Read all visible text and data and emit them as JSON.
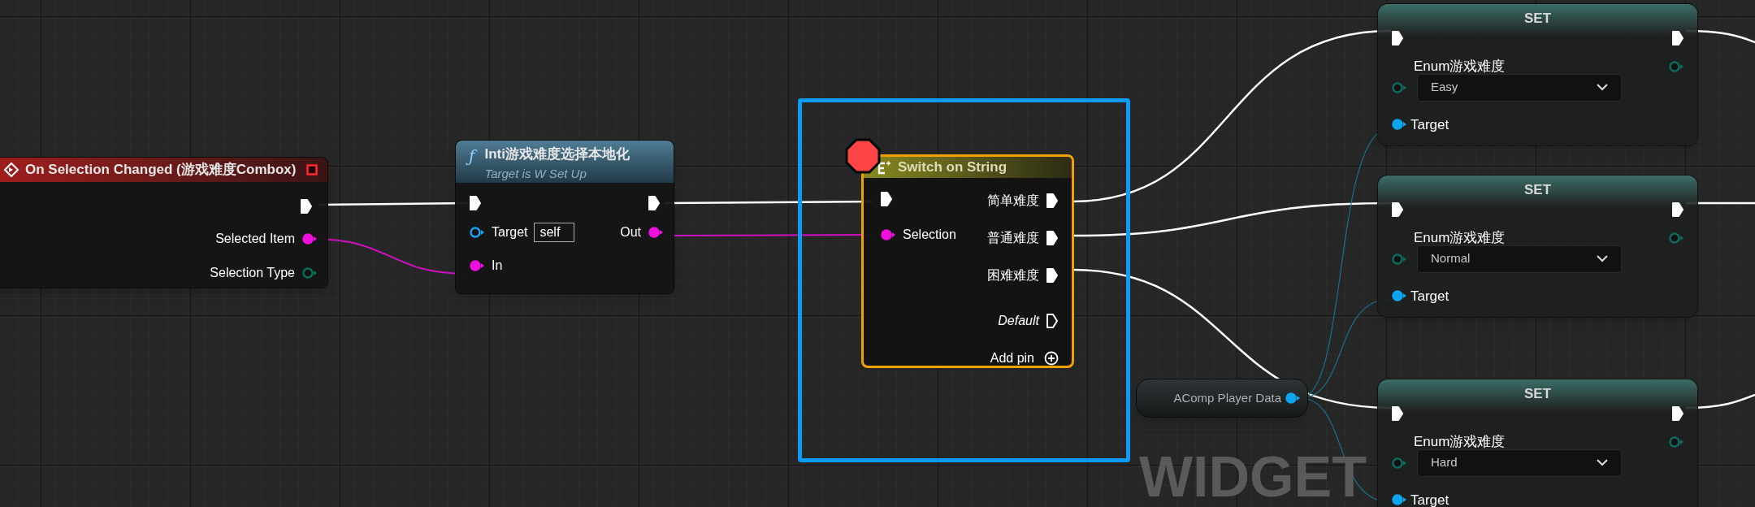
{
  "event_node": {
    "title": "On Selection Changed (游戏难度Combox)",
    "pins": [
      {
        "label": "Selected Item",
        "kind": "object"
      },
      {
        "label": "Selection Type",
        "kind": "enum"
      }
    ]
  },
  "function_node": {
    "icon": "ƒ",
    "title": "Inti游戏难度选择本地化",
    "subtitle": "Target is W Set Up",
    "inputs": [
      {
        "label": "Target",
        "kind": "target",
        "value": "self"
      },
      {
        "label": "In",
        "kind": "object"
      }
    ],
    "outputs": [
      {
        "label": "Out",
        "kind": "object"
      }
    ]
  },
  "switch_node": {
    "title": "Switch on String",
    "selected": true,
    "breakpoint": true,
    "input": "Selection",
    "cases": [
      "简单难度",
      "普通难度",
      "困难难度"
    ],
    "default": "Default",
    "add_pin": "Add pin"
  },
  "set_nodes": [
    {
      "title": "SET",
      "variable": "Enum游戏难度",
      "value": "Easy",
      "target": "Target"
    },
    {
      "title": "SET",
      "variable": "Enum游戏难度",
      "value": "Normal",
      "target": "Target"
    },
    {
      "title": "SET",
      "variable": "Enum游戏难度",
      "value": "Hard",
      "target": "Target"
    }
  ],
  "variable_node": {
    "label": "AComp Player Data"
  },
  "graph_watermark": "WIDGET"
}
